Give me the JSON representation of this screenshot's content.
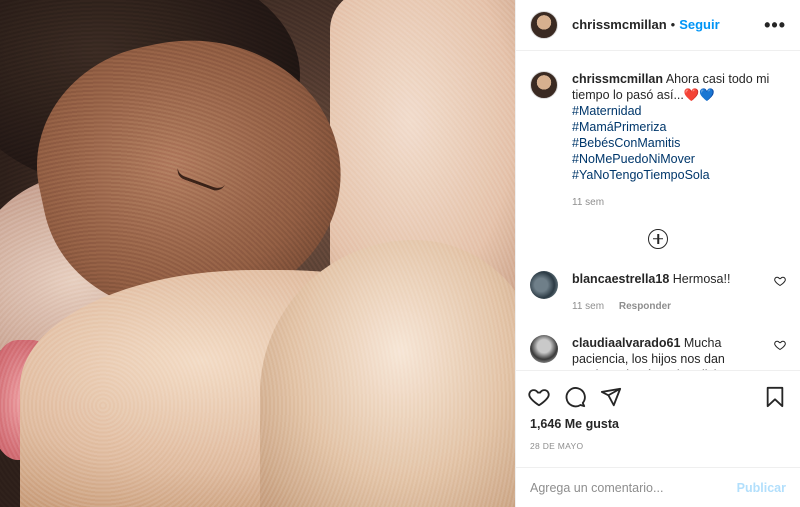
{
  "post": {
    "author": "chrissmcmillan",
    "separator": "•",
    "follow_label": "Seguir",
    "more_label": "•••"
  },
  "caption": {
    "username": "chrissmcmillan",
    "text": "Ahora casi todo mi tiempo lo pasó así...❤️💙",
    "hashtags": [
      "#Maternidad",
      "#MamáPrimeriza",
      "#BebésConMamitis",
      "#NoMePuedoNiMover",
      "#YaNoTengoTiempoSola"
    ],
    "time": "11 sem"
  },
  "comments": [
    {
      "username": "blancaestrella18",
      "text": "Hermosa!!",
      "time": "11 sem",
      "reply_label": "Responder"
    },
    {
      "username": "claudiaalvarado61",
      "text": "Mucha paciencia, los hijos nos dan muchas alegrías y bendiciones a"
    }
  ],
  "likes": "1,646 Me gusta",
  "date": "28 DE MAYO",
  "composer": {
    "placeholder": "Agrega un comentario...",
    "publish_label": "Publicar"
  },
  "colors": {
    "follow": "#0095f6",
    "hashtag": "#00376b",
    "muted": "#8e8e8e",
    "publish_disabled": "#b2dffc"
  },
  "icons": [
    "more-options-icon",
    "add-circle-icon",
    "heart-icon",
    "comment-icon",
    "share-icon",
    "bookmark-icon",
    "comment-like-icon"
  ]
}
